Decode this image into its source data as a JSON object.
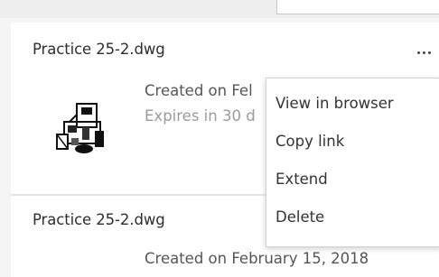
{
  "files": [
    {
      "name": "Practice 25-2.dwg",
      "created": "Created on Fel",
      "expires": "Expires in 30 d"
    },
    {
      "name": "Practice 25-2.dwg",
      "created": "Created on February 15, 2018"
    }
  ],
  "context_menu": {
    "items": [
      {
        "label": "View in browser"
      },
      {
        "label": "Copy link"
      },
      {
        "label": "Extend"
      },
      {
        "label": "Delete"
      }
    ]
  },
  "icons": {
    "more": "more-horizontal-icon",
    "thumbnail": "drawing-thumbnail"
  },
  "colors": {
    "page_background": "#f5f5f5",
    "card_background": "#ffffff",
    "menu_border": "#d2d2d2",
    "muted_text": "#9b9b9b"
  }
}
